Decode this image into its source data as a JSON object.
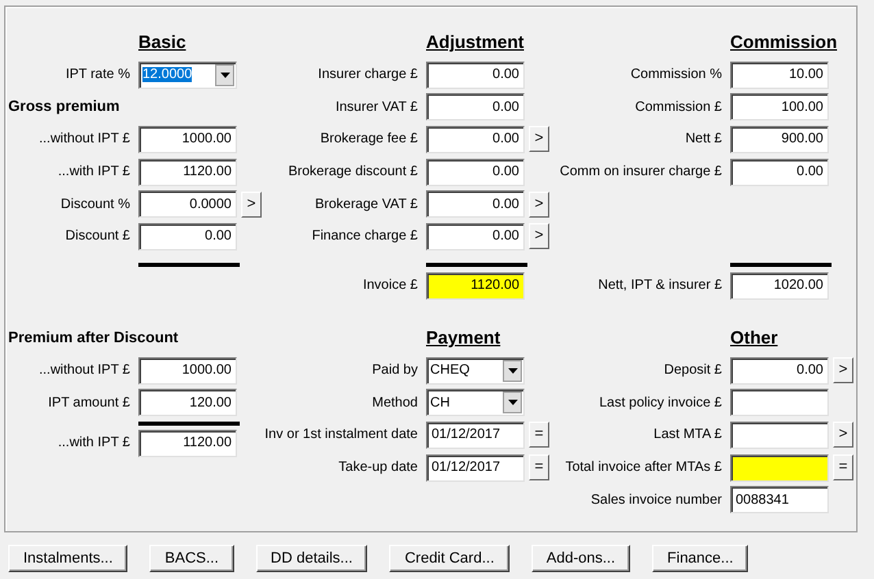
{
  "top_sections": [
    {
      "heading": "Basic",
      "rule": true,
      "rows": [
        {
          "kind": "dropdown",
          "label": "IPT rate %",
          "value": "12.0000",
          "selected": true
        },
        {
          "kind": "subheading",
          "label": "Gross premium"
        },
        {
          "kind": "number",
          "label": "...without IPT £",
          "value": "1000.00"
        },
        {
          "kind": "number",
          "label": "...with IPT £",
          "value": "1120.00"
        },
        {
          "kind": "number",
          "label": "Discount %",
          "value": "0.0000",
          "button": ">"
        },
        {
          "kind": "number",
          "label": "Discount £",
          "value": "0.00"
        }
      ]
    },
    {
      "heading": "Adjustment",
      "rule": true,
      "rows": [
        {
          "kind": "number",
          "label": "Insurer charge £",
          "value": "0.00"
        },
        {
          "kind": "number",
          "label": "Insurer VAT £",
          "value": "0.00"
        },
        {
          "kind": "number",
          "label": "Brokerage fee £",
          "value": "0.00",
          "button": ">"
        },
        {
          "kind": "number",
          "label": "Brokerage discount £",
          "value": "0.00"
        },
        {
          "kind": "number",
          "label": "Brokerage VAT £",
          "value": "0.00",
          "button": ">"
        },
        {
          "kind": "number",
          "label": "Finance charge £",
          "value": "0.00",
          "button": ">"
        }
      ],
      "total": {
        "label": "Invoice £",
        "value": "1120.00",
        "highlight": true
      }
    },
    {
      "heading": "Commission",
      "rule": true,
      "rows": [
        {
          "kind": "number",
          "label": "Commission %",
          "value": "10.00"
        },
        {
          "kind": "number",
          "label": "Commission £",
          "value": "100.00"
        },
        {
          "kind": "number",
          "label": "Nett £",
          "value": "900.00"
        },
        {
          "kind": "number",
          "label": "Comm on insurer charge £",
          "value": "0.00"
        }
      ],
      "total": {
        "label": "Nett, IPT & insurer £",
        "value": "1020.00",
        "highlight": false
      }
    }
  ],
  "bottom_sections": [
    {
      "heading": "Premium after Discount",
      "underlined": false,
      "rows": [
        {
          "kind": "number",
          "label": "...without IPT £",
          "value": "1000.00"
        },
        {
          "kind": "number",
          "label": "IPT amount £",
          "value": "120.00"
        },
        {
          "kind": "number",
          "label": "...with IPT £",
          "value": "1120.00",
          "rule_above": true
        }
      ]
    },
    {
      "heading": "Payment",
      "underlined": true,
      "rows": [
        {
          "kind": "dropdown",
          "label": "Paid by",
          "value": "CHEQ",
          "selected": false
        },
        {
          "kind": "dropdown",
          "label": "Method",
          "value": "CH",
          "selected": false
        },
        {
          "kind": "text",
          "label": "Inv or 1st instalment date",
          "value": "01/12/2017",
          "button": "="
        },
        {
          "kind": "text",
          "label": "Take-up date",
          "value": "01/12/2017",
          "button": "="
        }
      ]
    },
    {
      "heading": "Other",
      "underlined": true,
      "rows": [
        {
          "kind": "number",
          "label": "Deposit £",
          "value": "0.00",
          "button": ">"
        },
        {
          "kind": "number",
          "label": "Last policy invoice £"
        },
        {
          "kind": "number",
          "label": "Last MTA £",
          "button": ">"
        },
        {
          "kind": "number",
          "label": "Total invoice after MTAs £",
          "button": "=",
          "highlight": true
        },
        {
          "kind": "text",
          "label": "Sales invoice number",
          "value": "0088341"
        }
      ]
    }
  ],
  "buttons": [
    "Instalments...",
    "BACS...",
    "DD details...",
    "Credit Card...",
    "Add-ons...",
    "Finance..."
  ]
}
